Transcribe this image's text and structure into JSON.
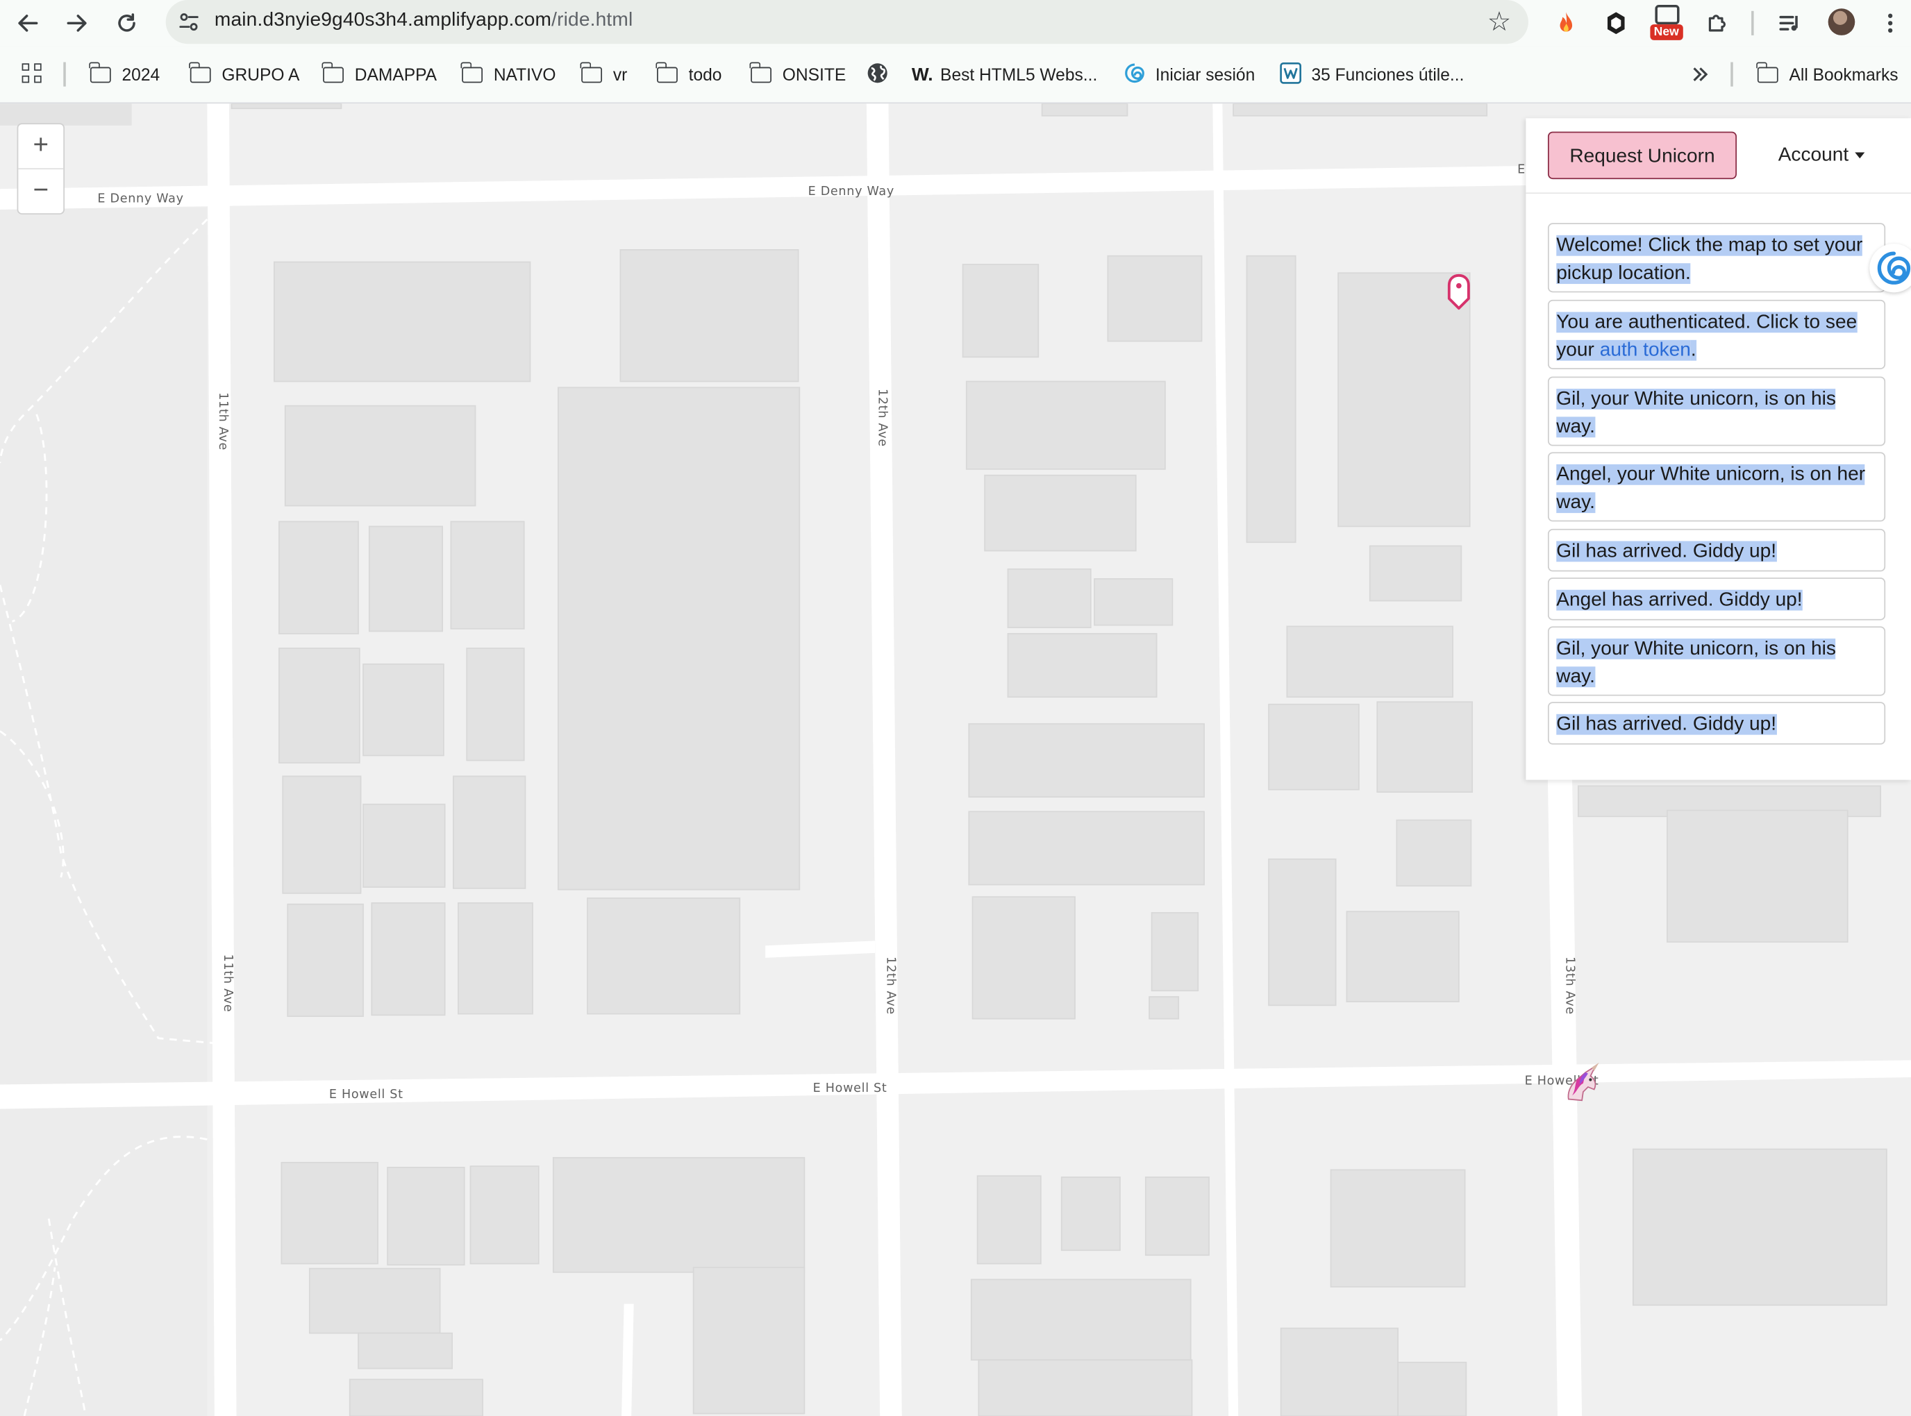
{
  "browser": {
    "url_host": "main.d3nyie9g40s3h4.amplifyapp.com",
    "url_path": "/ride.html",
    "ext_badge": "New",
    "bookmarks": [
      {
        "label": "2024",
        "icon": "folder-icon"
      },
      {
        "label": "GRUPO A",
        "icon": "folder-icon"
      },
      {
        "label": "DAMAPPA",
        "icon": "folder-icon"
      },
      {
        "label": "NATIVO",
        "icon": "folder-icon"
      },
      {
        "label": "vr",
        "icon": "folder-icon"
      },
      {
        "label": "todo",
        "icon": "folder-icon"
      },
      {
        "label": "ONSITE",
        "icon": "folder-icon"
      },
      {
        "label": "",
        "icon": "globe-icon"
      },
      {
        "label": "Best HTML5 Webs...",
        "icon": "w-logo-icon"
      },
      {
        "label": "Iniciar sesión",
        "icon": "swirl-logo-icon"
      },
      {
        "label": "35 Funciones útile...",
        "icon": "wordpress-icon"
      }
    ],
    "all_bookmarks": "All Bookmarks",
    "w_logo": "W."
  },
  "map": {
    "streets": {
      "denny_left": "E Denny Way",
      "denny_mid": "E Denny Way",
      "denny_right": "E",
      "howell_left": "E Howell St",
      "howell_mid": "E Howell St",
      "howell_right": "E Howell St",
      "ave11_top": "11th Ave",
      "ave11_bot": "11th Ave",
      "ave12_top": "12th Ave",
      "ave12_bot": "12th Ave",
      "ave13_bot": "13th Ave"
    },
    "zoom_in": "+",
    "zoom_out": "−"
  },
  "panel": {
    "request_button": "Request Unicorn",
    "account_menu": "Account",
    "messages": [
      {
        "text": "Welcome! Click the map to set your pickup location."
      },
      {
        "text_before": "You are authenticated. Click to see your ",
        "link": "auth token",
        "text_after": "."
      },
      {
        "text": "Gil, your White unicorn, is on his way."
      },
      {
        "text": "Angel, your White unicorn, is on her way."
      },
      {
        "text": "Gil has arrived. Giddy up!"
      },
      {
        "text": "Angel has arrived. Giddy up!"
      },
      {
        "text": "Gil, your White unicorn, is on his way."
      },
      {
        "text": "Gil has arrived. Giddy up!"
      }
    ]
  },
  "colors": {
    "request_button_bg": "#f7c1d0",
    "request_button_border": "#8a2d46",
    "selection_highlight": "#b4cdf4",
    "link": "#2a6bd6",
    "pin": "#d6336c"
  }
}
